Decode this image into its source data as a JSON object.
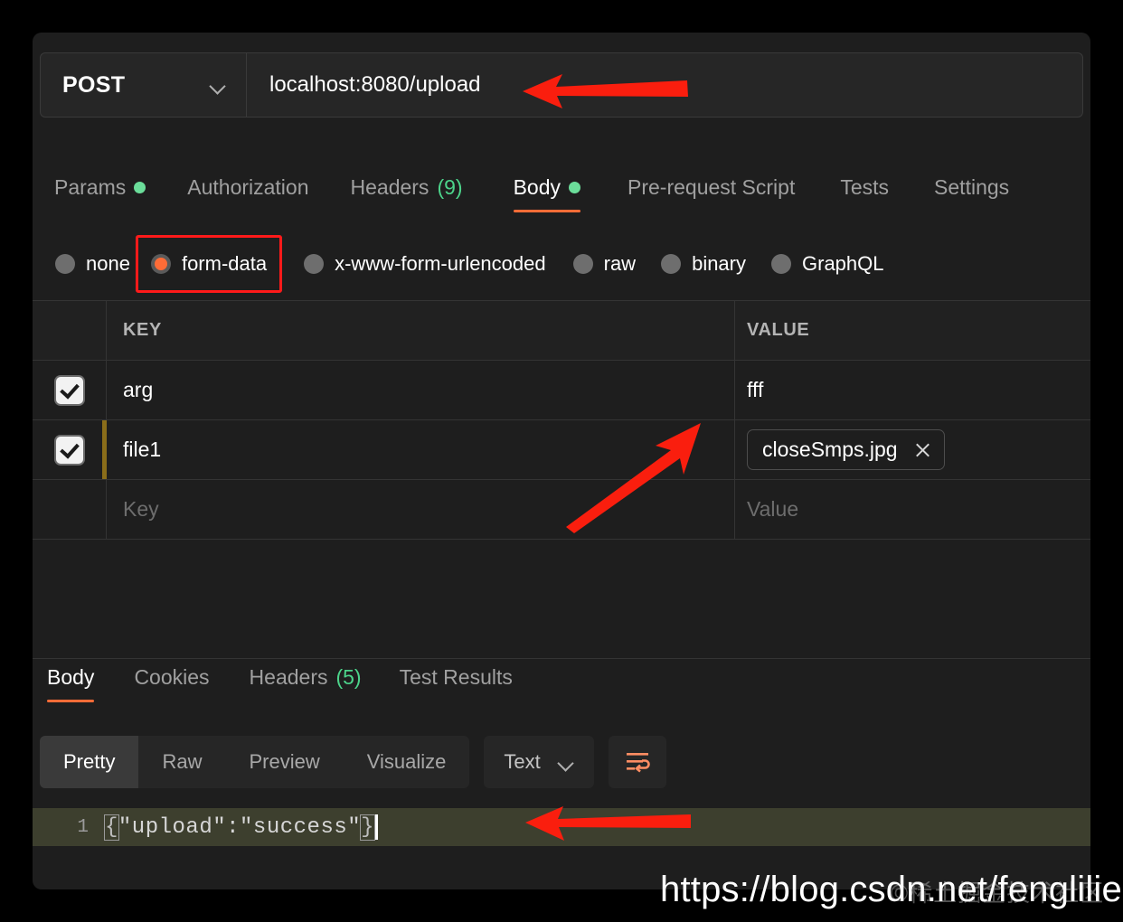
{
  "request": {
    "method": "POST",
    "method_icon": "chevron-down-icon",
    "url": "localhost:8080/upload",
    "tabs": [
      {
        "label": "Params",
        "indicator": "green-dot",
        "count": "",
        "active": false
      },
      {
        "label": "Authorization",
        "indicator": "",
        "count": "",
        "active": false
      },
      {
        "label": "Headers",
        "indicator": "",
        "count": "(9)",
        "active": false
      },
      {
        "label": "Body",
        "indicator": "green-dot",
        "count": "",
        "active": true
      },
      {
        "label": "Pre-request Script",
        "indicator": "",
        "count": "",
        "active": false
      },
      {
        "label": "Tests",
        "indicator": "",
        "count": "",
        "active": false
      },
      {
        "label": "Settings",
        "indicator": "",
        "count": "",
        "active": false
      }
    ],
    "body_modes": [
      {
        "label": "none",
        "selected": false,
        "highlighted": false
      },
      {
        "label": "form-data",
        "selected": true,
        "highlighted": true
      },
      {
        "label": "x-www-form-urlencoded",
        "selected": false,
        "highlighted": false
      },
      {
        "label": "raw",
        "selected": false,
        "highlighted": false
      },
      {
        "label": "binary",
        "selected": false,
        "highlighted": false
      },
      {
        "label": "GraphQL",
        "selected": false,
        "highlighted": false
      }
    ]
  },
  "form_table": {
    "headers": {
      "key": "KEY",
      "value": "VALUE"
    },
    "rows": [
      {
        "checked": true,
        "key": "arg",
        "value": "fff",
        "type": "text",
        "marked": false
      },
      {
        "checked": true,
        "key": "file1",
        "value": "closeSmps.jpg",
        "type": "file",
        "marked": true
      }
    ],
    "new_row": {
      "key_placeholder": "Key",
      "value_placeholder": "Value"
    },
    "file_remove_icon": "close-icon"
  },
  "response": {
    "tabs": [
      {
        "label": "Body",
        "count": "",
        "active": true
      },
      {
        "label": "Cookies",
        "count": "",
        "active": false
      },
      {
        "label": "Headers",
        "count": "(5)",
        "active": false
      },
      {
        "label": "Test Results",
        "count": "",
        "active": false
      }
    ],
    "format_segments": [
      {
        "label": "Pretty",
        "active": true
      },
      {
        "label": "Raw",
        "active": false
      },
      {
        "label": "Preview",
        "active": false
      },
      {
        "label": "Visualize",
        "active": false
      }
    ],
    "language": "Text",
    "language_icon": "chevron-down-icon",
    "wrap_icon": "word-wrap-icon",
    "code": {
      "line_number": "1",
      "open_brace": "{",
      "content": "\"upload\":\"success\"",
      "close_brace": "}"
    }
  },
  "annotations": {
    "arrow_url": "arrow-pointing-to-url",
    "arrow_file": "arrow-pointing-to-file-value",
    "arrow_response": "arrow-pointing-to-response-body",
    "highlight_box": "red-box-around-form-data",
    "arrow_color": "#fa1e0e",
    "box_color": "#ff1a1a"
  },
  "watermarks": {
    "url": "https://blog.csdn.net/fenglilie",
    "cn": "©稀土掘金技术社区"
  },
  "colors": {
    "accent": "#ff6c37",
    "panel": "#1e1e1e",
    "background": "#000000",
    "green": "#6bdd9a",
    "code_highlight": "#3d3f2e"
  }
}
